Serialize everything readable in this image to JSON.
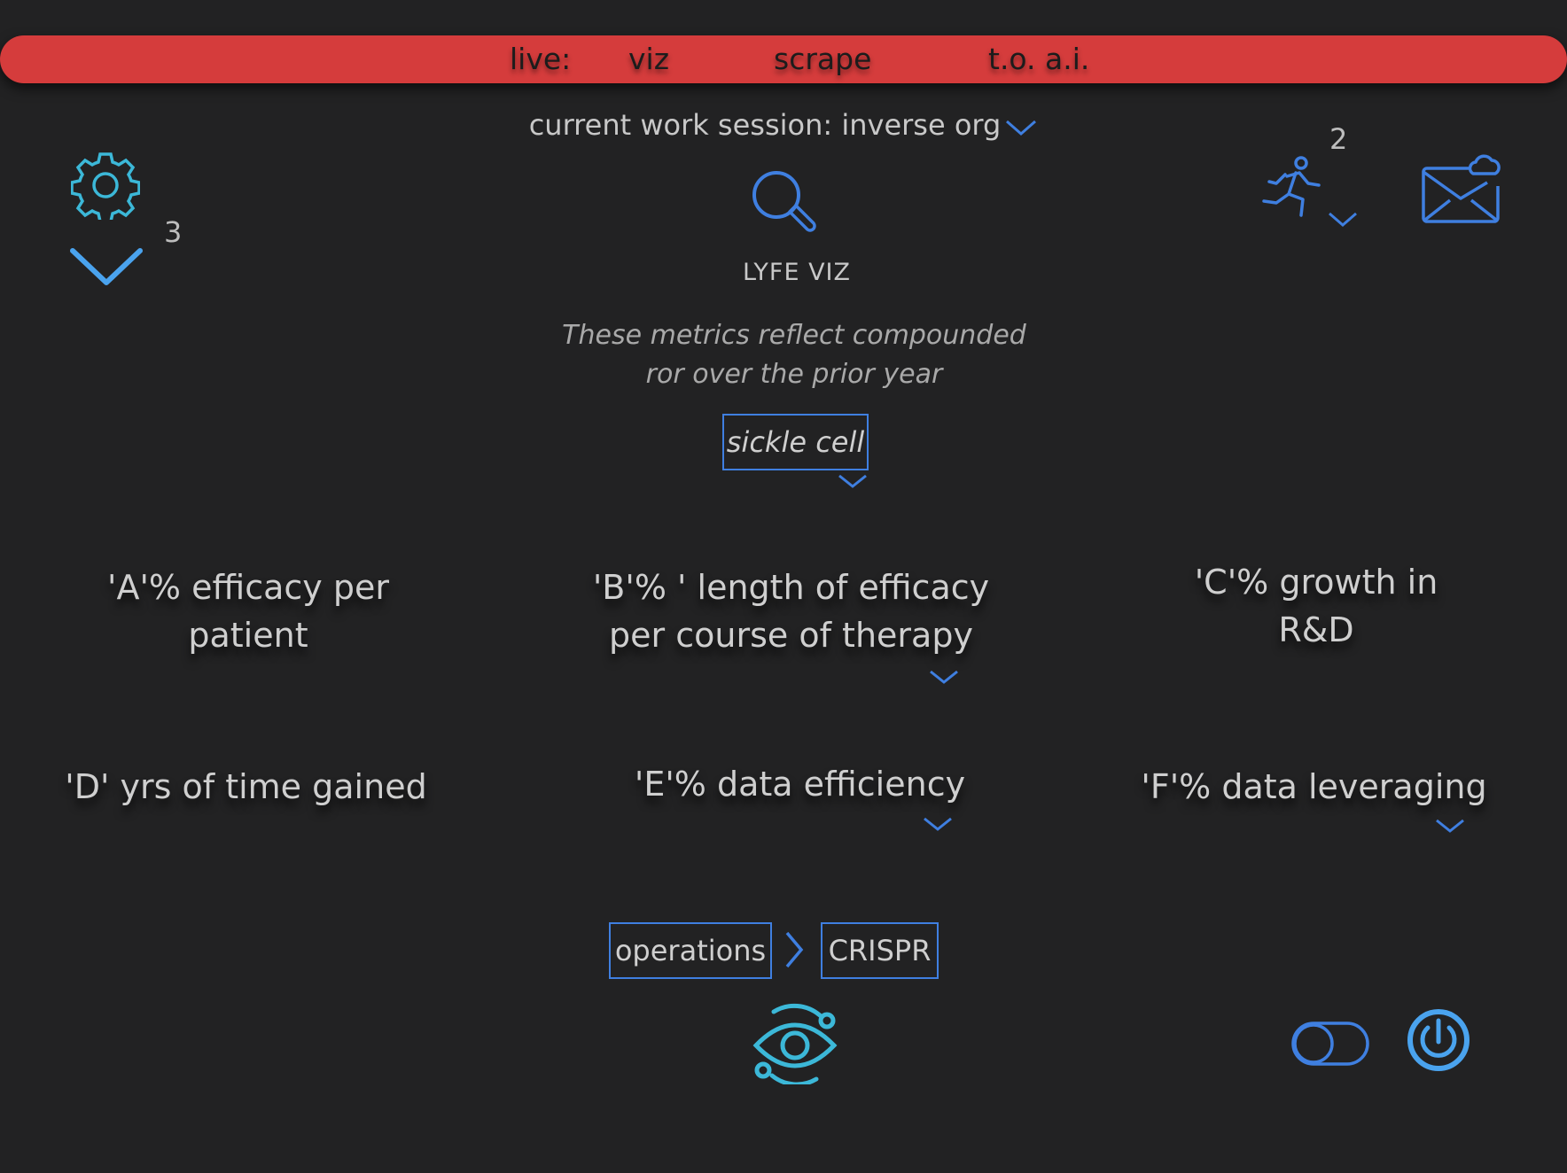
{
  "topbar": {
    "live_label": "live:",
    "links": [
      "viz",
      "scrape",
      "t.o. a.i."
    ],
    "color": "#d53c3c"
  },
  "session": {
    "label": "current work session: inverse org"
  },
  "left_panel": {
    "count": "3",
    "icons": [
      "gear-icon",
      "chevron-down-icon"
    ]
  },
  "right_panel": {
    "count": "2",
    "icons": [
      "runner-icon",
      "chevron-down-icon",
      "mail-cloud-icon"
    ]
  },
  "app": {
    "title": "LYFE VIZ",
    "subtitle_line1": "These metrics reflect compounded",
    "subtitle_line2": "ror over the prior year",
    "search_icon": "search-icon"
  },
  "condition_select": {
    "value": "sickle cell"
  },
  "metrics": {
    "a_line1": "'A'% efficacy per",
    "a_line2": "patient",
    "b_line1": "'B'% ' length of efficacy",
    "b_line2": "per course of therapy",
    "c_line1": "'C'% growth in",
    "c_line2": "R&D",
    "d": "'D' yrs of time gained",
    "e": "'E'% data efficiency",
    "f": "'F'% data leveraging"
  },
  "breadcrumb": {
    "first": "operations",
    "second": "CRISPR"
  },
  "bottom_icons": [
    "eye-icon",
    "toggle-icon",
    "power-icon"
  ],
  "colors": {
    "accent_blue": "#3f7fe0",
    "accent_cyan": "#3cb8d8",
    "background": "#222223"
  }
}
